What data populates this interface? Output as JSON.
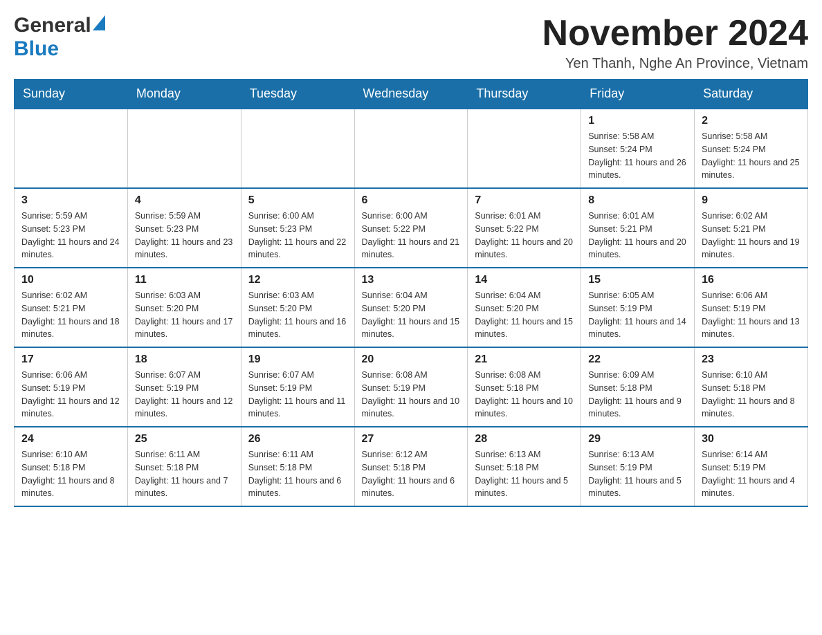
{
  "header": {
    "logo_general": "General",
    "logo_blue": "Blue",
    "month_year": "November 2024",
    "location": "Yen Thanh, Nghe An Province, Vietnam"
  },
  "days_of_week": [
    "Sunday",
    "Monday",
    "Tuesday",
    "Wednesday",
    "Thursday",
    "Friday",
    "Saturday"
  ],
  "weeks": [
    {
      "days": [
        {
          "number": "",
          "info": ""
        },
        {
          "number": "",
          "info": ""
        },
        {
          "number": "",
          "info": ""
        },
        {
          "number": "",
          "info": ""
        },
        {
          "number": "",
          "info": ""
        },
        {
          "number": "1",
          "info": "Sunrise: 5:58 AM\nSunset: 5:24 PM\nDaylight: 11 hours and 26 minutes."
        },
        {
          "number": "2",
          "info": "Sunrise: 5:58 AM\nSunset: 5:24 PM\nDaylight: 11 hours and 25 minutes."
        }
      ]
    },
    {
      "days": [
        {
          "number": "3",
          "info": "Sunrise: 5:59 AM\nSunset: 5:23 PM\nDaylight: 11 hours and 24 minutes."
        },
        {
          "number": "4",
          "info": "Sunrise: 5:59 AM\nSunset: 5:23 PM\nDaylight: 11 hours and 23 minutes."
        },
        {
          "number": "5",
          "info": "Sunrise: 6:00 AM\nSunset: 5:23 PM\nDaylight: 11 hours and 22 minutes."
        },
        {
          "number": "6",
          "info": "Sunrise: 6:00 AM\nSunset: 5:22 PM\nDaylight: 11 hours and 21 minutes."
        },
        {
          "number": "7",
          "info": "Sunrise: 6:01 AM\nSunset: 5:22 PM\nDaylight: 11 hours and 20 minutes."
        },
        {
          "number": "8",
          "info": "Sunrise: 6:01 AM\nSunset: 5:21 PM\nDaylight: 11 hours and 20 minutes."
        },
        {
          "number": "9",
          "info": "Sunrise: 6:02 AM\nSunset: 5:21 PM\nDaylight: 11 hours and 19 minutes."
        }
      ]
    },
    {
      "days": [
        {
          "number": "10",
          "info": "Sunrise: 6:02 AM\nSunset: 5:21 PM\nDaylight: 11 hours and 18 minutes."
        },
        {
          "number": "11",
          "info": "Sunrise: 6:03 AM\nSunset: 5:20 PM\nDaylight: 11 hours and 17 minutes."
        },
        {
          "number": "12",
          "info": "Sunrise: 6:03 AM\nSunset: 5:20 PM\nDaylight: 11 hours and 16 minutes."
        },
        {
          "number": "13",
          "info": "Sunrise: 6:04 AM\nSunset: 5:20 PM\nDaylight: 11 hours and 15 minutes."
        },
        {
          "number": "14",
          "info": "Sunrise: 6:04 AM\nSunset: 5:20 PM\nDaylight: 11 hours and 15 minutes."
        },
        {
          "number": "15",
          "info": "Sunrise: 6:05 AM\nSunset: 5:19 PM\nDaylight: 11 hours and 14 minutes."
        },
        {
          "number": "16",
          "info": "Sunrise: 6:06 AM\nSunset: 5:19 PM\nDaylight: 11 hours and 13 minutes."
        }
      ]
    },
    {
      "days": [
        {
          "number": "17",
          "info": "Sunrise: 6:06 AM\nSunset: 5:19 PM\nDaylight: 11 hours and 12 minutes."
        },
        {
          "number": "18",
          "info": "Sunrise: 6:07 AM\nSunset: 5:19 PM\nDaylight: 11 hours and 12 minutes."
        },
        {
          "number": "19",
          "info": "Sunrise: 6:07 AM\nSunset: 5:19 PM\nDaylight: 11 hours and 11 minutes."
        },
        {
          "number": "20",
          "info": "Sunrise: 6:08 AM\nSunset: 5:19 PM\nDaylight: 11 hours and 10 minutes."
        },
        {
          "number": "21",
          "info": "Sunrise: 6:08 AM\nSunset: 5:18 PM\nDaylight: 11 hours and 10 minutes."
        },
        {
          "number": "22",
          "info": "Sunrise: 6:09 AM\nSunset: 5:18 PM\nDaylight: 11 hours and 9 minutes."
        },
        {
          "number": "23",
          "info": "Sunrise: 6:10 AM\nSunset: 5:18 PM\nDaylight: 11 hours and 8 minutes."
        }
      ]
    },
    {
      "days": [
        {
          "number": "24",
          "info": "Sunrise: 6:10 AM\nSunset: 5:18 PM\nDaylight: 11 hours and 8 minutes."
        },
        {
          "number": "25",
          "info": "Sunrise: 6:11 AM\nSunset: 5:18 PM\nDaylight: 11 hours and 7 minutes."
        },
        {
          "number": "26",
          "info": "Sunrise: 6:11 AM\nSunset: 5:18 PM\nDaylight: 11 hours and 6 minutes."
        },
        {
          "number": "27",
          "info": "Sunrise: 6:12 AM\nSunset: 5:18 PM\nDaylight: 11 hours and 6 minutes."
        },
        {
          "number": "28",
          "info": "Sunrise: 6:13 AM\nSunset: 5:18 PM\nDaylight: 11 hours and 5 minutes."
        },
        {
          "number": "29",
          "info": "Sunrise: 6:13 AM\nSunset: 5:19 PM\nDaylight: 11 hours and 5 minutes."
        },
        {
          "number": "30",
          "info": "Sunrise: 6:14 AM\nSunset: 5:19 PM\nDaylight: 11 hours and 4 minutes."
        }
      ]
    }
  ]
}
